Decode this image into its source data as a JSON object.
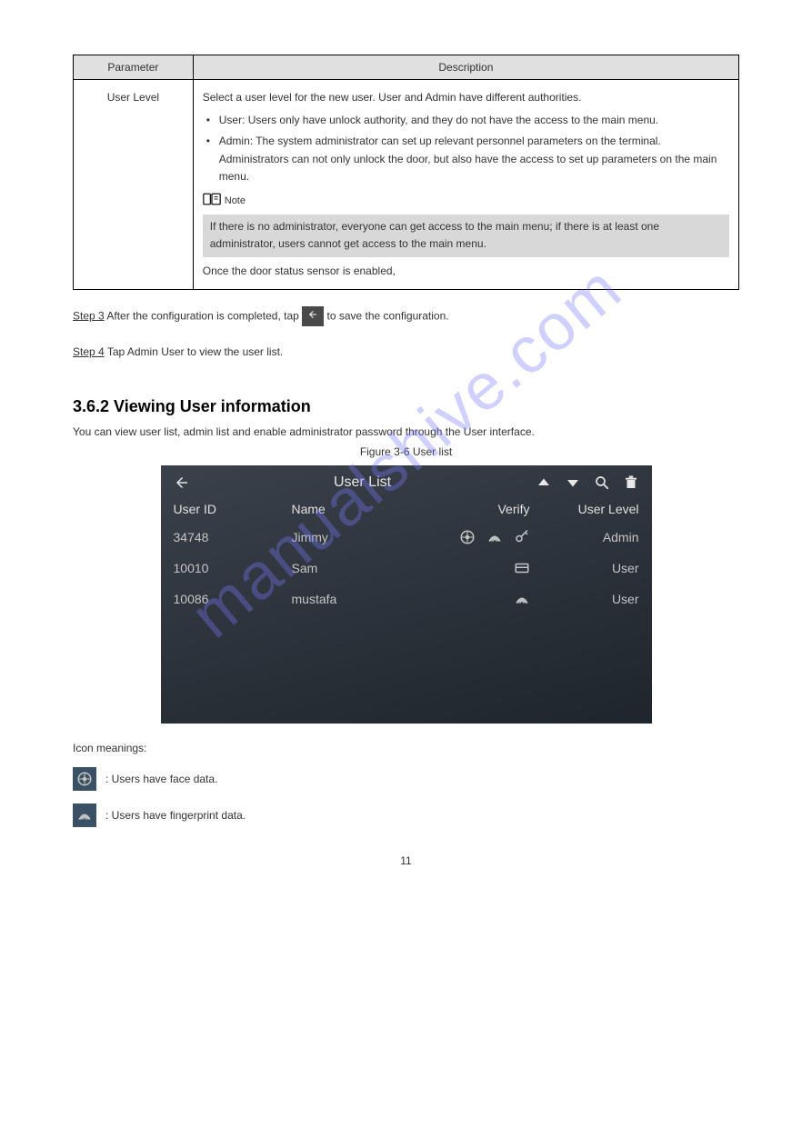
{
  "table": {
    "header_param": "Parameter",
    "header_desc": "Description",
    "row_param": "User Level",
    "desc_intro": "Select a user level for the new user. User and Admin have different authorities.",
    "desc_user": "User: Users only have unlock authority, and they do not have the access to the main menu.",
    "desc_admin": "Admin: The system administrator can set up relevant personnel parameters on the terminal. Administrators can not only unlock the door, but also have the access to set up parameters on the main menu.",
    "note_label": "Note",
    "note_text": "If there is no administrator, everyone can get access to the main menu; if there is at least one administrator, users cannot get access to the main menu.",
    "tail": "Once the door status sensor is enabled,"
  },
  "step3_prefix": "Step 3",
  "step3_text": "After the configuration is completed, tap",
  "step3_tail": "to save the configuration.",
  "step4_prefix": "Step 4",
  "step4_text": "Tap Admin User to view the user list.",
  "section_heading": "3.6.2 Viewing User information",
  "section_body": "You can view user list, admin list and enable administrator password through the User interface.",
  "figure_caption": "Figure 3-6 User list",
  "screenshot": {
    "title": "User List",
    "col_id": "User ID",
    "col_name": "Name",
    "col_verify": "Verify",
    "col_level": "User Level",
    "rows": [
      {
        "id": "34748",
        "name": "Jimmy",
        "icons": [
          "face",
          "fp",
          "key"
        ],
        "level": "Admin"
      },
      {
        "id": "10010",
        "name": "Sam",
        "icons": [
          "card"
        ],
        "level": "User"
      },
      {
        "id": "10086",
        "name": "mustafa",
        "icons": [
          "fp"
        ],
        "level": "User"
      }
    ]
  },
  "meanings_intro": "Icon meanings:",
  "meanings": {
    "face": ": Users have face data.",
    "fp": ": Users have fingerprint data."
  },
  "page_number": "11",
  "watermark": "manualshive.com"
}
